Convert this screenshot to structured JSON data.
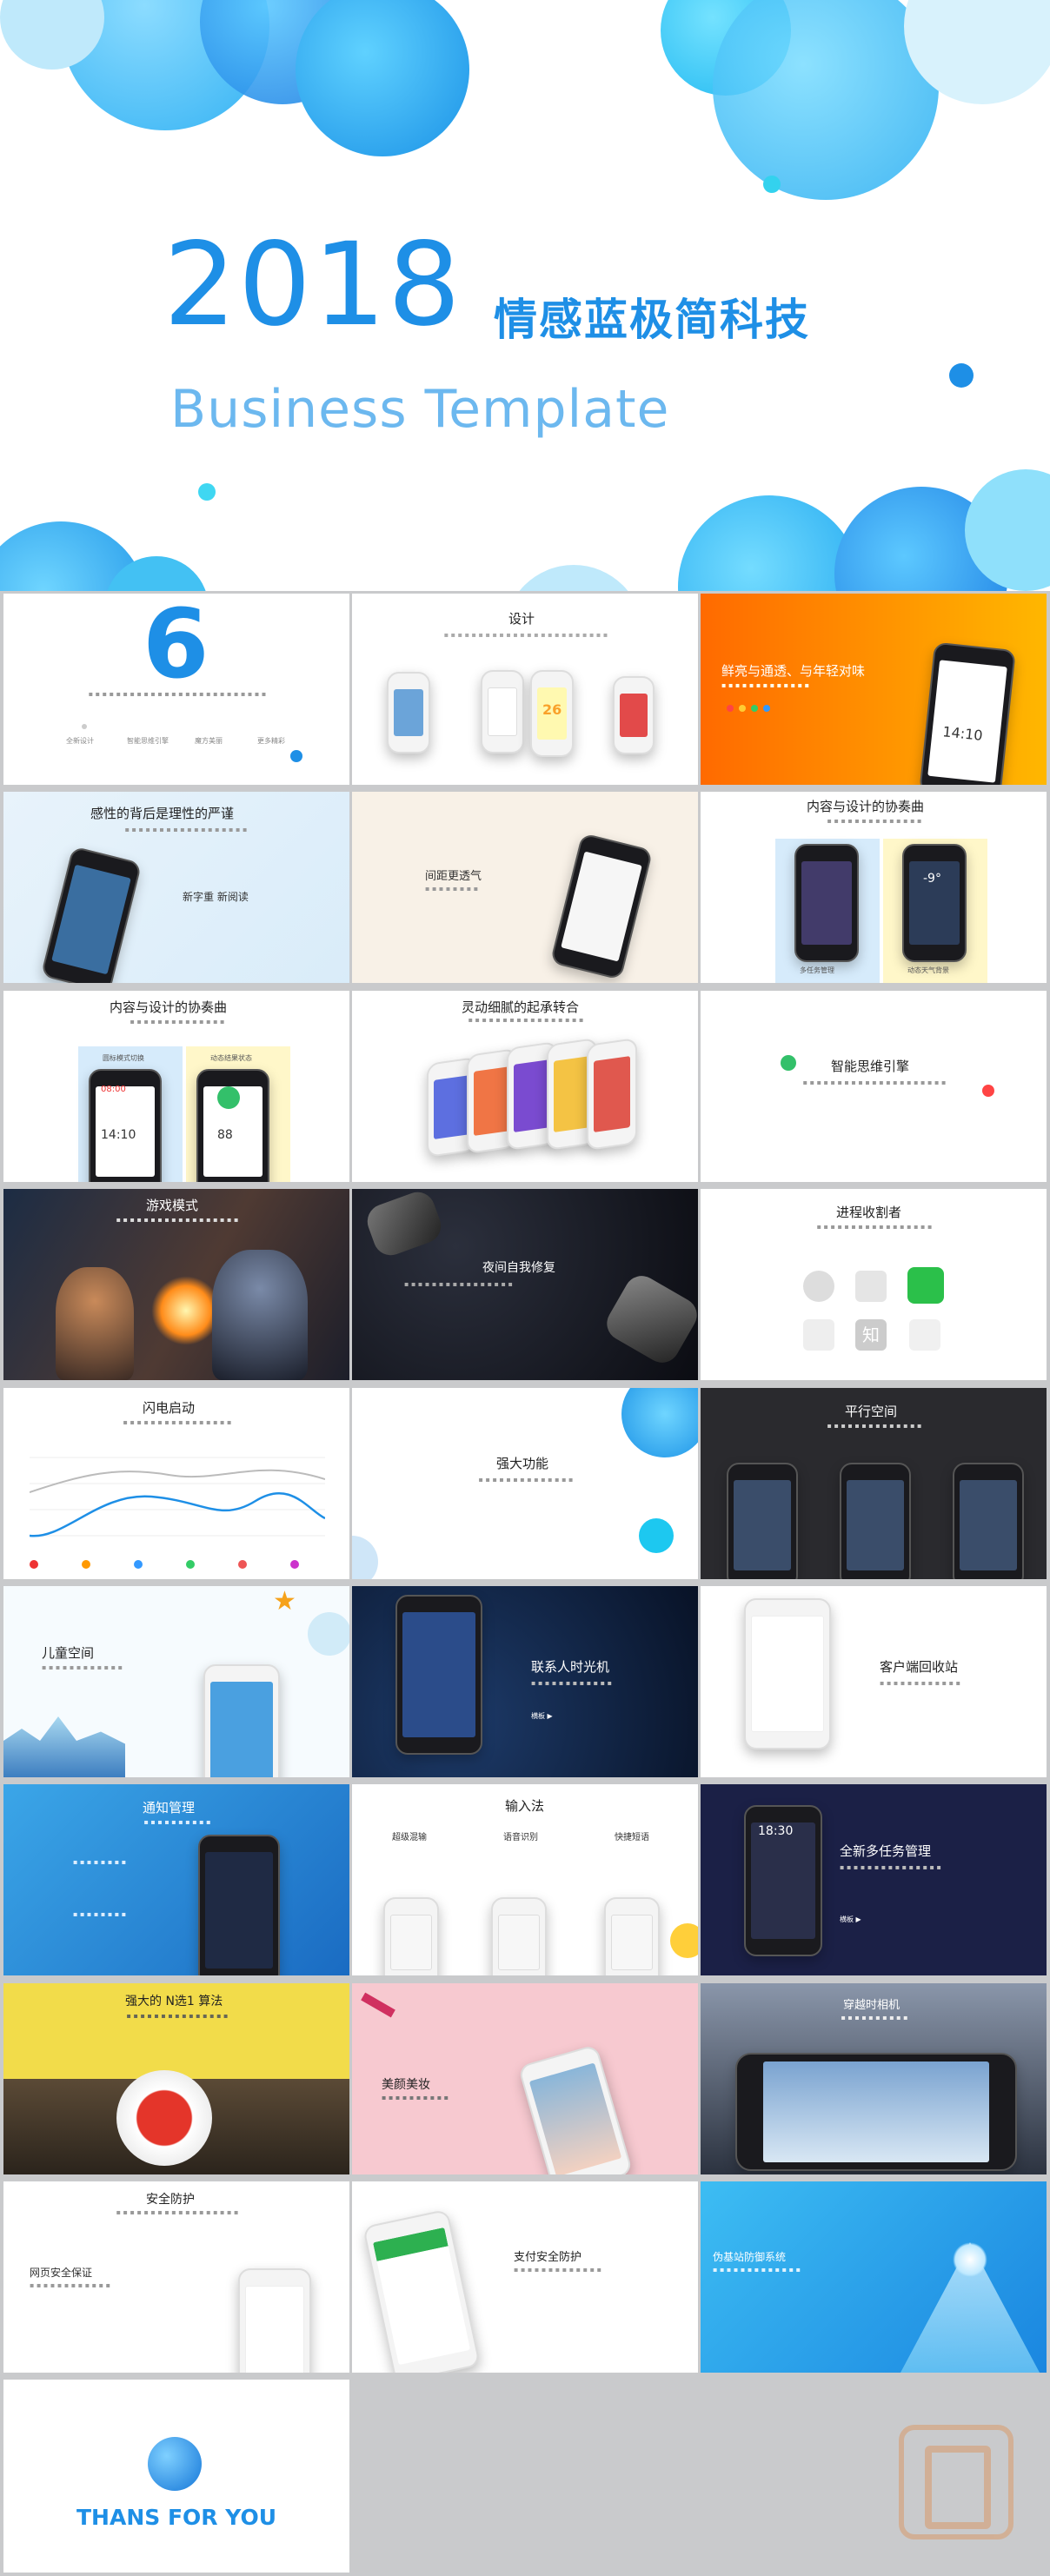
{
  "hero": {
    "year": "2018",
    "title_cn": "情感蓝极简科技",
    "subtitle": "Business Template"
  },
  "slides": {
    "s1": {
      "number": "6",
      "items": [
        "全新设计",
        "智能思维引擎",
        "魔方美丽",
        "更多精彩"
      ]
    },
    "s2": {
      "title": "设计",
      "phone_number": "26"
    },
    "s3": {
      "title": "鲜亮与通透、与年轻对味",
      "time": "14:10"
    },
    "s4": {
      "title": "感性的背后是理性的严谨",
      "caption": "新字重 新阅读"
    },
    "s5": {
      "caption": "间距更透气"
    },
    "s6": {
      "title": "内容与设计的协奏曲",
      "temp": "-9°",
      "cap_left": "多任务管理",
      "cap_right": "动态天气背景"
    },
    "s7": {
      "title": "内容与设计的协奏曲",
      "cap_left": "圆标模式切换",
      "cap_right": "动态结果状态",
      "time": "14:10",
      "num_left": "08:00",
      "num_right": "88"
    },
    "s8": {
      "title": "灵动细腻的起承转合"
    },
    "s9": {
      "title": "智能思维引擎"
    },
    "s10": {
      "title": "游戏模式"
    },
    "s11": {
      "title": "夜间自我修复"
    },
    "s12": {
      "title": "进程收割者",
      "icon_char": "知"
    },
    "s13": {
      "title": "闪电启动"
    },
    "s14": {
      "title": "强大功能"
    },
    "s15": {
      "title": "平行空间"
    },
    "s16": {
      "title": "儿童空间"
    },
    "s17": {
      "title": "联系人时光机",
      "link": "横板 ▶"
    },
    "s18": {
      "title": "客户端回收站"
    },
    "s19": {
      "title": "通知管理"
    },
    "s20": {
      "title": "输入法",
      "col1": "超级混输",
      "col2": "语音识别",
      "col3": "快捷短语"
    },
    "s21": {
      "title": "全新多任务管理",
      "time": "18:30",
      "link": "横板 ▶"
    },
    "s22": {
      "title": "强大的 N选1 算法"
    },
    "s23": {
      "title": "美颜美妆"
    },
    "s24": {
      "title": "穿越时相机"
    },
    "s25": {
      "title": "安全防护",
      "subtitle": "网页安全保证"
    },
    "s26": {
      "title": "支付安全防护"
    },
    "s27": {
      "title": "伪基站防御系统"
    },
    "s28": {
      "text": "THANS FOR YOU"
    }
  },
  "colors": {
    "primary": "#1e8fe6",
    "cyan": "#1dc8f0",
    "orange": "#ff8c1a",
    "dark_navy": "#14183a",
    "yellow": "#f2dc4a",
    "pink": "#f7c9d0"
  }
}
